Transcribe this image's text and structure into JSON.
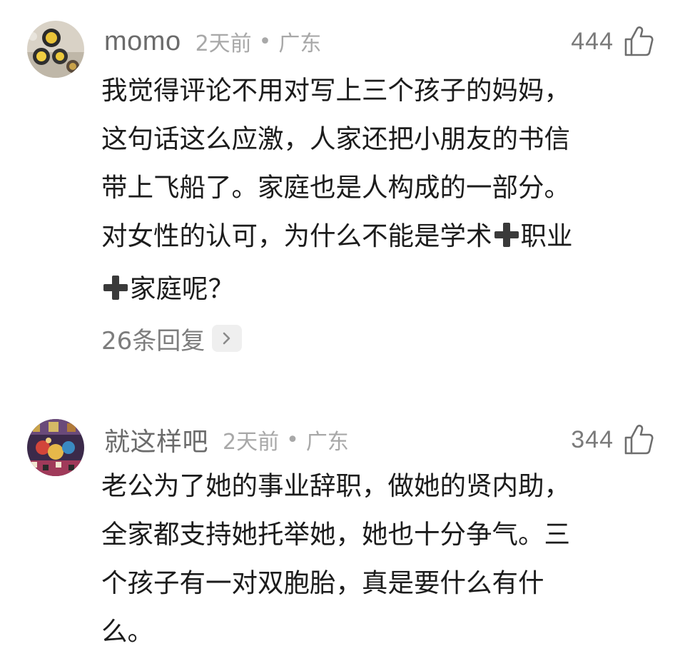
{
  "comments": [
    {
      "username": "momo",
      "time": "2天前",
      "separator": "•",
      "region": "广东",
      "likes": "444",
      "avatar_icon": "food-photo-avatar",
      "lines": [
        "我觉得评论不用对写上三个孩子的妈妈，",
        "这句话这么应激，人家还把小朋友的书信",
        "带上飞船了。家庭也是人构成的一部分。",
        "对女性的认可，为什么不能是学术",
        "职业",
        "家庭呢？"
      ],
      "replies_label": "26条回复",
      "replies_icon": "chevron-right-icon"
    },
    {
      "username": "就这样吧",
      "time": "2天前",
      "separator": "•",
      "region": "广东",
      "likes": "344",
      "avatar_icon": "colorful-photo-avatar",
      "lines": [
        "老公为了她的事业辞职，做她的贤内助，",
        "全家都支持她托举她，她也十分争气。三",
        "个孩子有一对双胞胎，真是要什么有什",
        "么。"
      ]
    }
  ],
  "icons": {
    "like": "thumbs-up-icon",
    "plus": "heavy-plus-emoji"
  },
  "colors": {
    "username": "#6b6b6b",
    "meta": "#a8a8a8",
    "body": "#1c1c1c",
    "plus_emoji": "#3a3a3a"
  }
}
